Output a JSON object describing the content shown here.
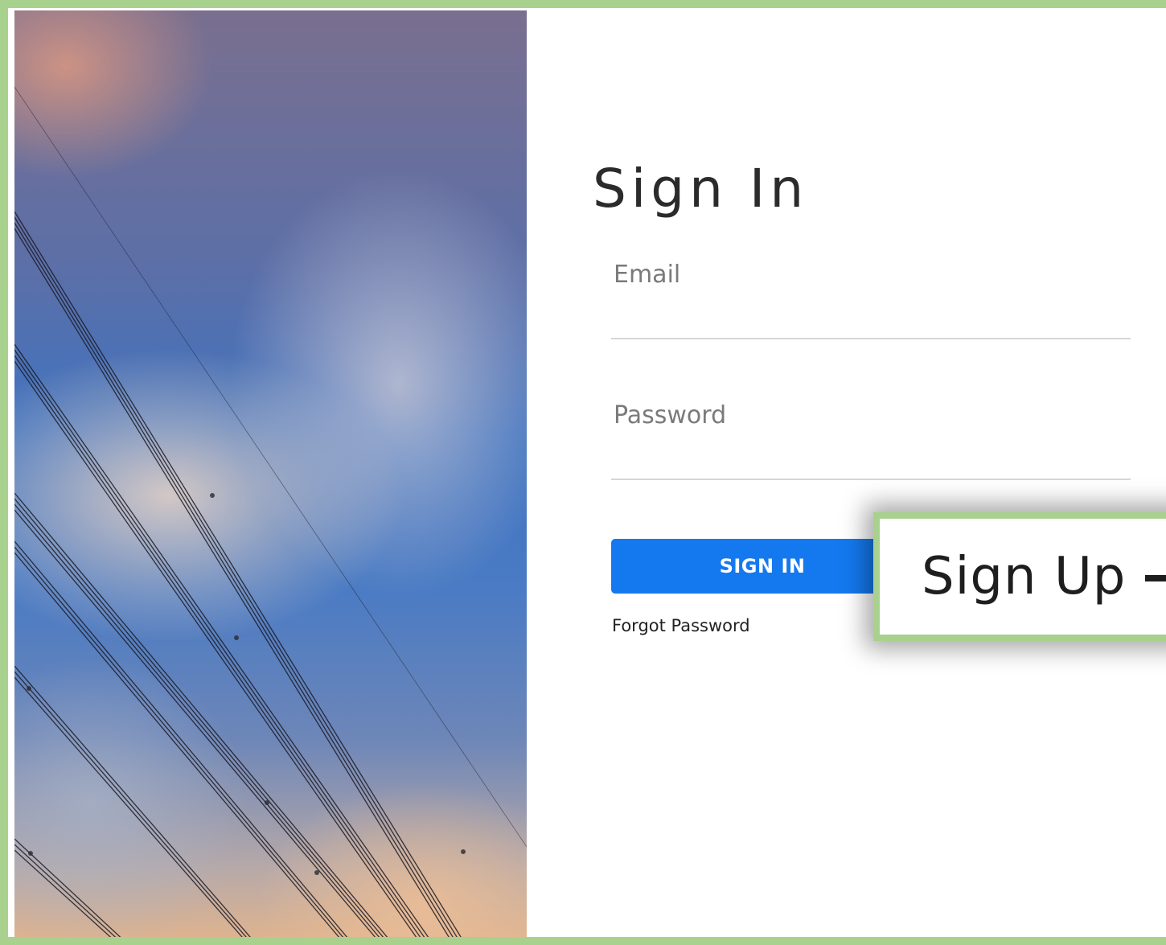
{
  "login": {
    "title": "Sign In",
    "email_label": "Email",
    "email_value": "",
    "password_label": "Password",
    "password_value": "",
    "signin_button": "SIGN IN",
    "forgot_link": "Forgot Password"
  },
  "callout": {
    "signup_label": "Sign Up",
    "signup_icon": "sign-in-arrow-icon"
  },
  "colors": {
    "frame_border": "#a8d18d",
    "primary_button": "#1479ee",
    "label_text": "#7a7a7a"
  }
}
